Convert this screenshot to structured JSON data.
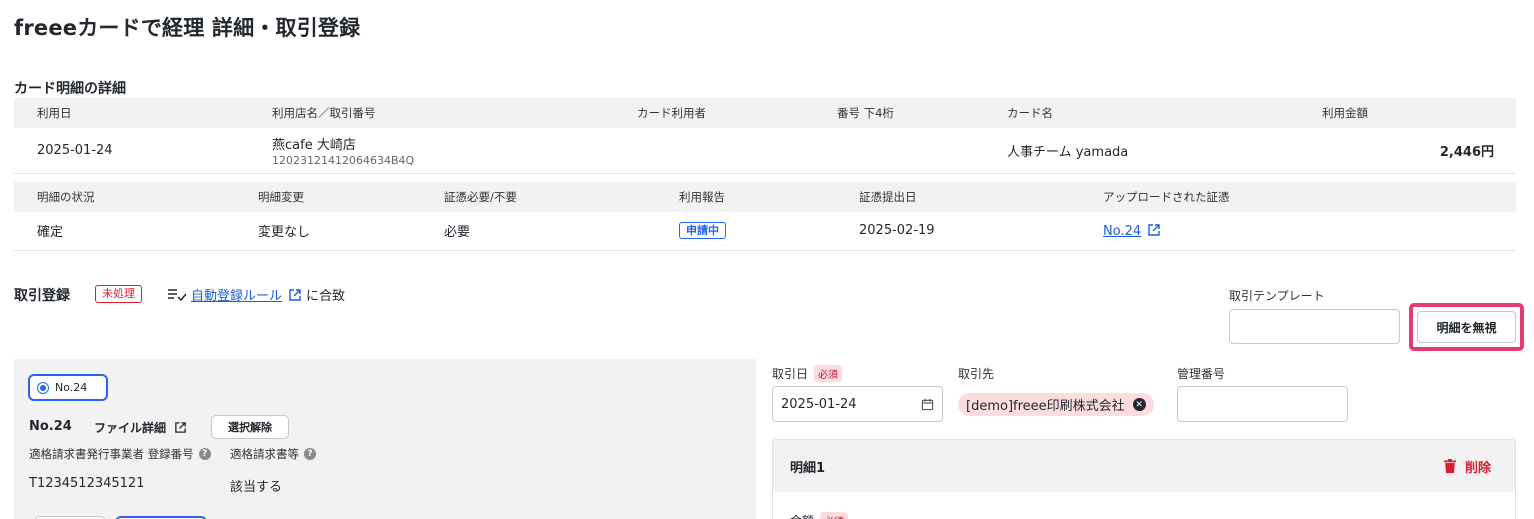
{
  "page": {
    "title": "freeeカードで経理 詳細・取引登録"
  },
  "card_details": {
    "section_title": "カード明細の詳細",
    "table1": {
      "headers": [
        "利用日",
        "利用店名／取引番号",
        "カード利用者",
        "番号 下4桁",
        "カード名",
        "利用金額"
      ],
      "row": {
        "date": "2025-01-24",
        "store": "燕cafe 大崎店",
        "tx_number": "12023121412064634B4Q",
        "user": "",
        "last4": "",
        "card_name": "人事チーム yamada",
        "amount": "2,446円"
      }
    },
    "table2": {
      "headers": [
        "明細の状況",
        "明細変更",
        "証憑必要/不要",
        "利用報告",
        "証憑提出日",
        "アップロードされた証憑"
      ],
      "row": {
        "status": "確定",
        "change": "変更なし",
        "evidence_required": "必要",
        "report": "申請中",
        "submitted_date": "2025-02-19",
        "uploaded_evidence": "No.24"
      }
    }
  },
  "registration": {
    "title": "取引登録",
    "status_badge": "未処理",
    "rule_link": "自動登録ルール",
    "rule_suffix": "に合致",
    "template_label": "取引テンプレート",
    "template_value": "",
    "ignore_button": "明細を無視"
  },
  "evidence_panel": {
    "radio_label": "No.24",
    "number": "No.24",
    "file_detail": "ファイル詳細",
    "deselect_button": "選択解除",
    "invoice_issuer_label": "適格請求書発行事業者 登録番号",
    "invoice_issuer_value": "T1234512345121",
    "invoice_type_label": "適格請求書等",
    "invoice_type_value": "該当する"
  },
  "form": {
    "date_label": "取引日",
    "required": "必須",
    "date_value": "2025-01-24",
    "partner_label": "取引先",
    "partner_value": "[demo]freee印刷株式会社",
    "mgmt_label": "管理番号",
    "mgmt_value": "",
    "line_title": "明細1",
    "delete_label": "削除",
    "amount_label": "金額"
  },
  "colors": {
    "accent": "#2864f0",
    "danger": "#dc1e32",
    "highlight": "#e6397a"
  }
}
